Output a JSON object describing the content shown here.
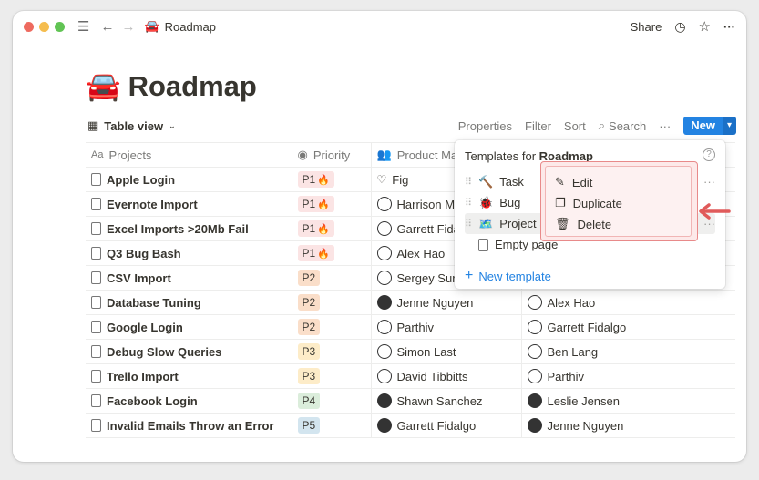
{
  "topbar": {
    "page": "Roadmap",
    "share": "Share",
    "icons": [
      "hamburger-icon",
      "back-arrow-icon",
      "forward-arrow-icon",
      "clock-icon",
      "star-icon",
      "more-icon"
    ]
  },
  "page": {
    "emoji": "🚘",
    "title": "Roadmap"
  },
  "viewbar": {
    "view": "Table view",
    "properties": "Properties",
    "filter": "Filter",
    "sort": "Sort",
    "search": "Search",
    "more": "···",
    "new": "New"
  },
  "columns": [
    "Projects",
    "Priority",
    "Product Man"
  ],
  "rows": [
    {
      "project": "Apple Login",
      "priority": "P1",
      "fire": true,
      "pm": "Fig",
      "pm_icon": "heart",
      "c4": ""
    },
    {
      "project": "Evernote Import",
      "priority": "P1",
      "fire": true,
      "pm": "Harrison Me",
      "c4": ""
    },
    {
      "project": "Excel Imports >20Mb Fail",
      "priority": "P1",
      "fire": true,
      "pm": "Garrett Fida",
      "c4": ""
    },
    {
      "project": "Q3 Bug Bash",
      "priority": "P1",
      "fire": true,
      "pm": "Alex Hao",
      "c4": ""
    },
    {
      "project": "CSV Import",
      "priority": "P2",
      "fire": false,
      "pm": "Sergey Surg",
      "c4": ""
    },
    {
      "project": "Database Tuning",
      "priority": "P2",
      "fire": false,
      "pm": "Jenne Nguyen",
      "c4": "Alex Hao"
    },
    {
      "project": "Google Login",
      "priority": "P2",
      "fire": false,
      "pm": "Parthiv",
      "c4": "Garrett Fidalgo"
    },
    {
      "project": "Debug Slow Queries",
      "priority": "P3",
      "fire": false,
      "pm": "Simon Last",
      "c4": "Ben Lang"
    },
    {
      "project": "Trello Import",
      "priority": "P3",
      "fire": false,
      "pm": "David Tibbitts",
      "c4": "Parthiv"
    },
    {
      "project": "Facebook Login",
      "priority": "P4",
      "fire": false,
      "pm": "Shawn Sanchez",
      "c4": "Leslie Jensen"
    },
    {
      "project": "Invalid Emails Throw an Error",
      "priority": "P5",
      "fire": false,
      "pm": "Garrett Fidalgo",
      "c4": "Jenne Nguyen"
    }
  ],
  "templates_menu": {
    "header_prefix": "Templates for ",
    "header_name": "Roadmap",
    "help": "?",
    "items": [
      {
        "emoji": "🔨",
        "label": "Task"
      },
      {
        "emoji": "🐞",
        "label": "Bug"
      },
      {
        "emoji": "🗺️",
        "label": "Project S"
      }
    ],
    "empty_page": "Empty page",
    "new_template": "New template",
    "more": "···"
  },
  "context_menu": {
    "edit": "Edit",
    "duplicate": "Duplicate",
    "delete": "Delete"
  },
  "colors": {
    "accent": "#2383e2",
    "highlight_border": "#e88a8a",
    "arrow": "#e05a5a"
  }
}
